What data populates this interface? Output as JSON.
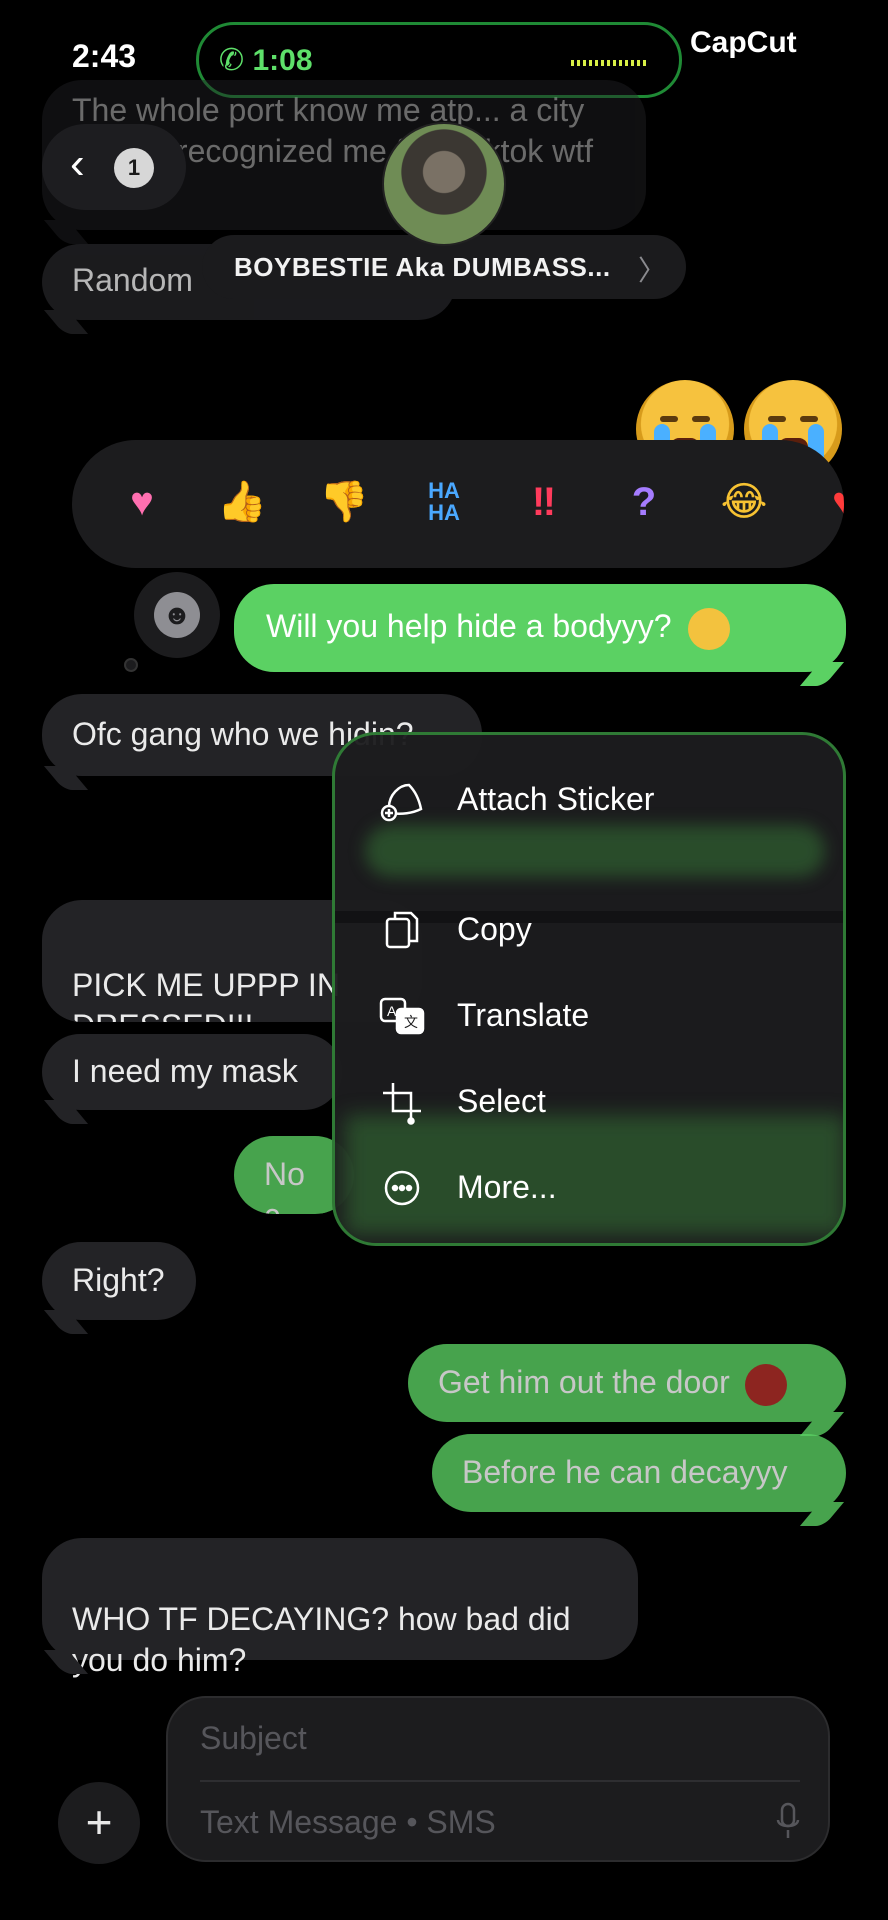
{
  "status_bar": {
    "time": "2:43",
    "call_timer": "1:08",
    "watermark": "CapCut"
  },
  "header": {
    "back_count": "1",
    "contact_name": "BOYBESTIE Aka DUMBASS...",
    "contact_chevron": "〉"
  },
  "messages": {
    "m1": "The whole port know me atp... a city worker recognized me from tiktok wtf",
    "m2": "Random",
    "m3": "Will you help hide a bodyyy?",
    "m4": "Ofc gang who we hidin?",
    "m5": "PICK ME UPPP IN\nDRESSED!!!",
    "m6": "I need my mask",
    "m7": "No c",
    "m8": "Right?",
    "m9": "Get him out the door",
    "m10": "Before he can decayyy",
    "m11": "WHO TF DECAYING? how bad did\nyou do him?"
  },
  "tapback": {
    "items": [
      "heart",
      "thumbs-up",
      "thumbs-down",
      "haha",
      "exclamation",
      "question",
      "laughing",
      "red-heart"
    ],
    "haha_label": "HA\nHA",
    "bang": "‼",
    "q": "?"
  },
  "context_menu": {
    "items": [
      {
        "label": "Attach Sticker",
        "icon": "sticker-icon"
      },
      {
        "label": "Copy",
        "icon": "copy-icon"
      },
      {
        "label": "Translate",
        "icon": "translate-icon"
      },
      {
        "label": "Select",
        "icon": "select-icon"
      },
      {
        "label": "More...",
        "icon": "more-icon"
      }
    ]
  },
  "composer": {
    "subject_placeholder": "Subject",
    "message_placeholder": "Text Message • SMS"
  },
  "colors": {
    "outgoing": "#5bd163",
    "incoming": "#232326",
    "background": "#000000"
  }
}
